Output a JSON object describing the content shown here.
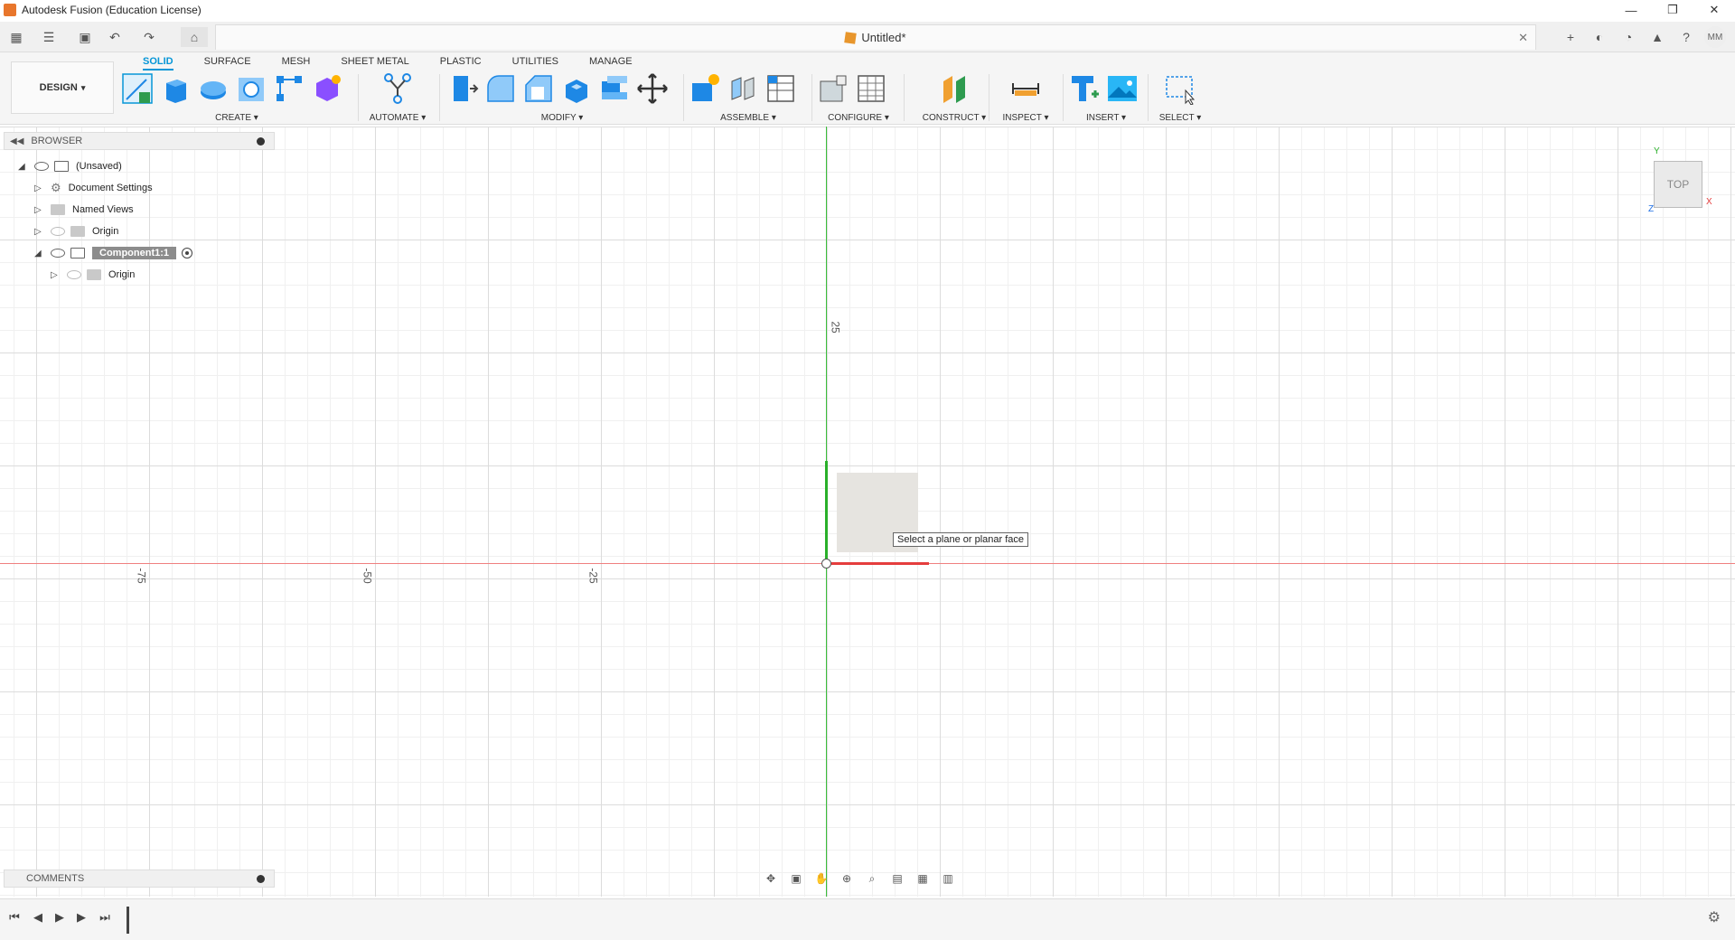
{
  "window": {
    "title": "Autodesk Fusion (Education License)",
    "minimize_glyph": "—",
    "restore_glyph": "❐",
    "close_glyph": "✕"
  },
  "quick_access": {
    "grid_glyph": "▦",
    "file_glyph": "☰",
    "save_glyph": "▣",
    "undo_glyph": "↶",
    "redo_glyph": "↷",
    "home_glyph": "⌂"
  },
  "document_tab": {
    "title": "Untitled*",
    "close_glyph": "✕"
  },
  "header_right": {
    "new_tab_glyph": "+",
    "extensions_glyph": "◐",
    "history_glyph": "◔",
    "notifications_glyph": "▲",
    "help_glyph": "?",
    "avatar": "MM"
  },
  "ribbon": {
    "workspace": "DESIGN",
    "workspace_caret": "▾",
    "tabs": [
      {
        "label": "SOLID",
        "active": true
      },
      {
        "label": "SURFACE",
        "active": false
      },
      {
        "label": "MESH",
        "active": false
      },
      {
        "label": "SHEET METAL",
        "active": false
      },
      {
        "label": "PLASTIC",
        "active": false
      },
      {
        "label": "UTILITIES",
        "active": false
      },
      {
        "label": "MANAGE",
        "active": false
      }
    ],
    "groups": {
      "create": "CREATE",
      "automate": "AUTOMATE",
      "modify": "MODIFY",
      "assemble": "ASSEMBLE",
      "configure": "CONFIGURE",
      "construct": "CONSTRUCT",
      "inspect": "INSPECT",
      "insert": "INSERT",
      "select": "SELECT"
    },
    "caret": "▾",
    "colors": {
      "active_tab": "#0696d7",
      "icon_blue": "#1e88e5",
      "icon_purple": "#8a4fff",
      "icon_green": "#2e9b4f",
      "icon_orange": "#e8762c"
    }
  },
  "browser": {
    "header": "BROWSER",
    "collapse_glyph": "◀◀",
    "items": [
      {
        "label": "(Unsaved)",
        "expanded": true
      },
      {
        "label": "Document Settings",
        "expanded": false
      },
      {
        "label": "Named Views",
        "expanded": false
      },
      {
        "label": "Origin",
        "expanded": false
      },
      {
        "label": "Component1:1",
        "expanded": true,
        "selected": true
      },
      {
        "label": "Origin",
        "expanded": false
      }
    ],
    "tri_open": "◢",
    "tri_closed": "▷",
    "gear_glyph": "⚙"
  },
  "canvas": {
    "tick_labels": [
      "-75",
      "-50",
      "-25",
      "25"
    ],
    "tooltip": "Select a plane or planar face",
    "viewcube_label": "TOP",
    "axis_labels": {
      "x": "X",
      "y": "Y",
      "z": "Z"
    },
    "colors": {
      "x_axis": "#e53d3d",
      "y_axis": "#2ab02a",
      "z_axis": "#1e6fe5",
      "grid_major": "#dcdcdc",
      "grid_minor": "#f0f0f0"
    }
  },
  "comments": {
    "label": "COMMENTS"
  },
  "nav_bar": {
    "orbit_glyph": "✥",
    "look_glyph": "▣",
    "pan_glyph": "✋",
    "zoom_glyph": "⊕",
    "fit_glyph": "⌕",
    "display_glyph": "▤",
    "grid_glyph": "▦",
    "viewports_glyph": "▥"
  },
  "timeline": {
    "first_glyph": "⏮",
    "prev_glyph": "◀",
    "play_glyph": "▶",
    "next_glyph": "▶",
    "last_glyph": "⏭",
    "settings_glyph": "⚙"
  }
}
